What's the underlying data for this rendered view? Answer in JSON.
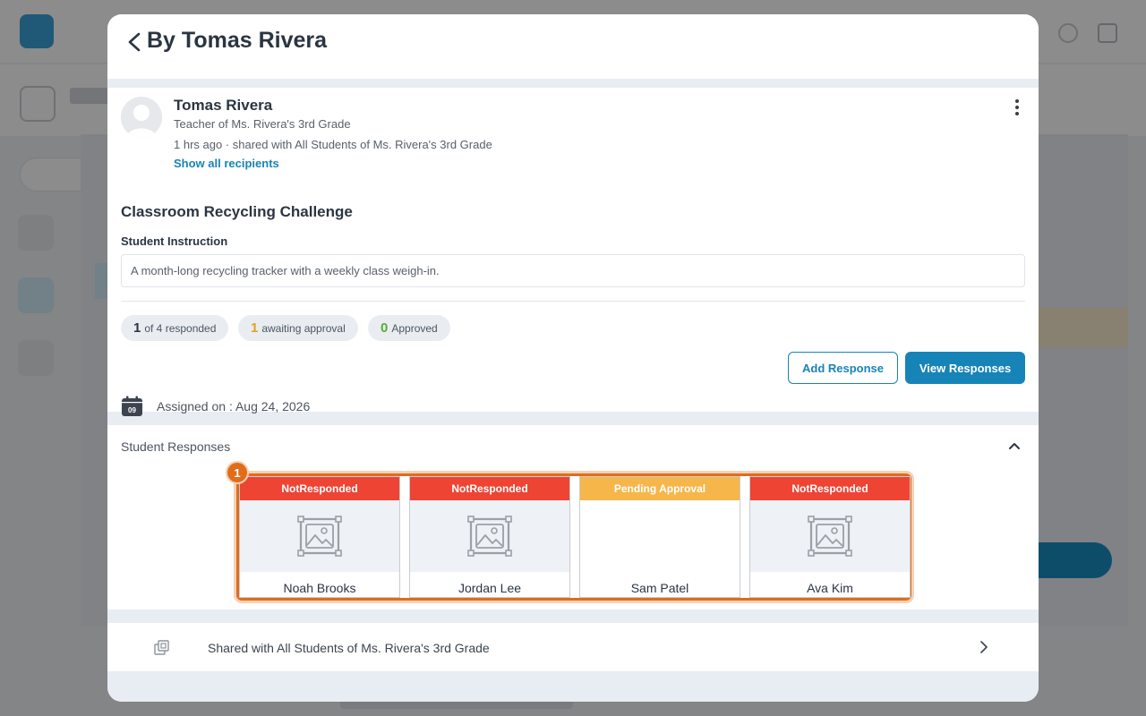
{
  "modal": {
    "title": "By Tomas Rivera"
  },
  "post": {
    "author": "Tomas Rivera",
    "role": "Teacher of Ms. Rivera's 3rd Grade",
    "meta": "1 hrs ago · shared with All Students of Ms. Rivera's 3rd Grade",
    "show_recipients": "Show all recipients",
    "task_title": "Classroom Recycling Challenge",
    "instruction_label": "Student Instruction",
    "instruction": "A month-long recycling tracker with a weekly class weigh-in.",
    "stats": {
      "responded_count": "1",
      "responded_label": "of 4 responded",
      "awaiting_count": "1",
      "awaiting_label": "awaiting approval",
      "approved_count": "0",
      "approved_label": "Approved"
    },
    "actions": {
      "add_response": "Add Response",
      "view_responses": "View Responses"
    },
    "calendar_day": "09",
    "assigned": "Assigned on : Aug 24, 2026"
  },
  "responses": {
    "title": "Student Responses",
    "badge_count": "1",
    "students": [
      {
        "name": "Noah Brooks",
        "status": "NotResponded"
      },
      {
        "name": "Jordan Lee",
        "status": "NotResponded"
      },
      {
        "name": "Sam Patel",
        "status": "Pending Approval"
      },
      {
        "name": "Ava Kim",
        "status": "NotResponded"
      }
    ]
  },
  "shared": {
    "text": "Shared with All Students of Ms. Rivera's 3rd Grade"
  },
  "colors": {
    "accent": "#1784b8",
    "not_responded": "#ee4434",
    "pending": "#f6b64a",
    "highlight": "#e06d1a",
    "approved": "#5aab35"
  }
}
